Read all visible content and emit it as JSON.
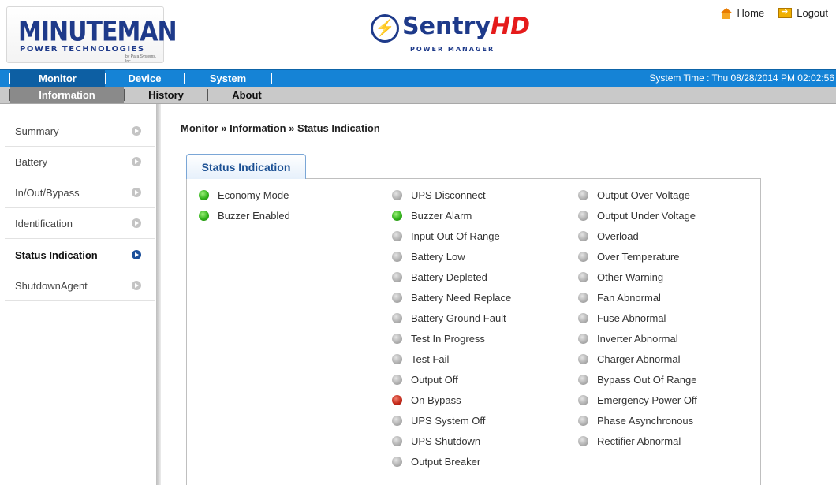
{
  "header": {
    "minuteman_logo": {
      "brand": "MINUTEMAN",
      "sub": "POWER TECHNOLOGIES",
      "tiny": "by Para Systems, Inc."
    },
    "sentry_logo": {
      "name": "Sentry",
      "name_suffix": "HD",
      "tagline": "POWER MANAGER"
    },
    "links": {
      "home": "Home",
      "logout": "Logout"
    }
  },
  "main_nav": {
    "items": [
      "Monitor",
      "Device",
      "System"
    ],
    "active": "Monitor",
    "system_time": "System Time : Thu 08/28/2014 PM 02:02:56"
  },
  "sub_nav": {
    "items": [
      "Information",
      "History",
      "About"
    ],
    "active": "Information"
  },
  "sidebar": {
    "items": [
      {
        "label": "Summary",
        "active": false
      },
      {
        "label": "Battery",
        "active": false
      },
      {
        "label": "In/Out/Bypass",
        "active": false
      },
      {
        "label": "Identification",
        "active": false
      },
      {
        "label": "Status Indication",
        "active": true
      },
      {
        "label": "ShutdownAgent",
        "active": false
      }
    ]
  },
  "content": {
    "breadcrumb": "Monitor » Information » Status Indication",
    "tab_label": "Status Indication",
    "columns": [
      [
        {
          "label": "Economy Mode",
          "state": "green"
        },
        {
          "label": "Buzzer Enabled",
          "state": "green"
        }
      ],
      [
        {
          "label": "UPS Disconnect",
          "state": "gray"
        },
        {
          "label": "Buzzer Alarm",
          "state": "green"
        },
        {
          "label": "Input Out Of Range",
          "state": "gray"
        },
        {
          "label": "Battery Low",
          "state": "gray"
        },
        {
          "label": "Battery Depleted",
          "state": "gray"
        },
        {
          "label": "Battery Need Replace",
          "state": "gray"
        },
        {
          "label": "Battery Ground Fault",
          "state": "gray"
        },
        {
          "label": "Test In Progress",
          "state": "gray"
        },
        {
          "label": "Test Fail",
          "state": "gray"
        },
        {
          "label": "Output Off",
          "state": "gray"
        },
        {
          "label": "On Bypass",
          "state": "red"
        },
        {
          "label": "UPS System Off",
          "state": "gray"
        },
        {
          "label": "UPS Shutdown",
          "state": "gray"
        },
        {
          "label": "Output Breaker",
          "state": "gray"
        }
      ],
      [
        {
          "label": "Output Over Voltage",
          "state": "gray"
        },
        {
          "label": "Output Under Voltage",
          "state": "gray"
        },
        {
          "label": "Overload",
          "state": "gray"
        },
        {
          "label": "Over Temperature",
          "state": "gray"
        },
        {
          "label": "Other Warning",
          "state": "gray"
        },
        {
          "label": "Fan Abnormal",
          "state": "gray"
        },
        {
          "label": "Fuse Abnormal",
          "state": "gray"
        },
        {
          "label": "Inverter Abnormal",
          "state": "gray"
        },
        {
          "label": "Charger Abnormal",
          "state": "gray"
        },
        {
          "label": "Bypass Out Of Range",
          "state": "gray"
        },
        {
          "label": "Emergency Power Off",
          "state": "gray"
        },
        {
          "label": "Phase Asynchronous",
          "state": "gray"
        },
        {
          "label": "Rectifier Abnormal",
          "state": "gray"
        }
      ]
    ]
  },
  "colors": {
    "main_nav_bg": "#1583d6",
    "sub_nav_bg": "#c9c9c9",
    "logo_blue": "#1e3a8a",
    "logo_red": "#e51b1b",
    "status_green": "#31b21a",
    "status_red": "#c52a1a",
    "status_gray": "#b3b3b3"
  }
}
